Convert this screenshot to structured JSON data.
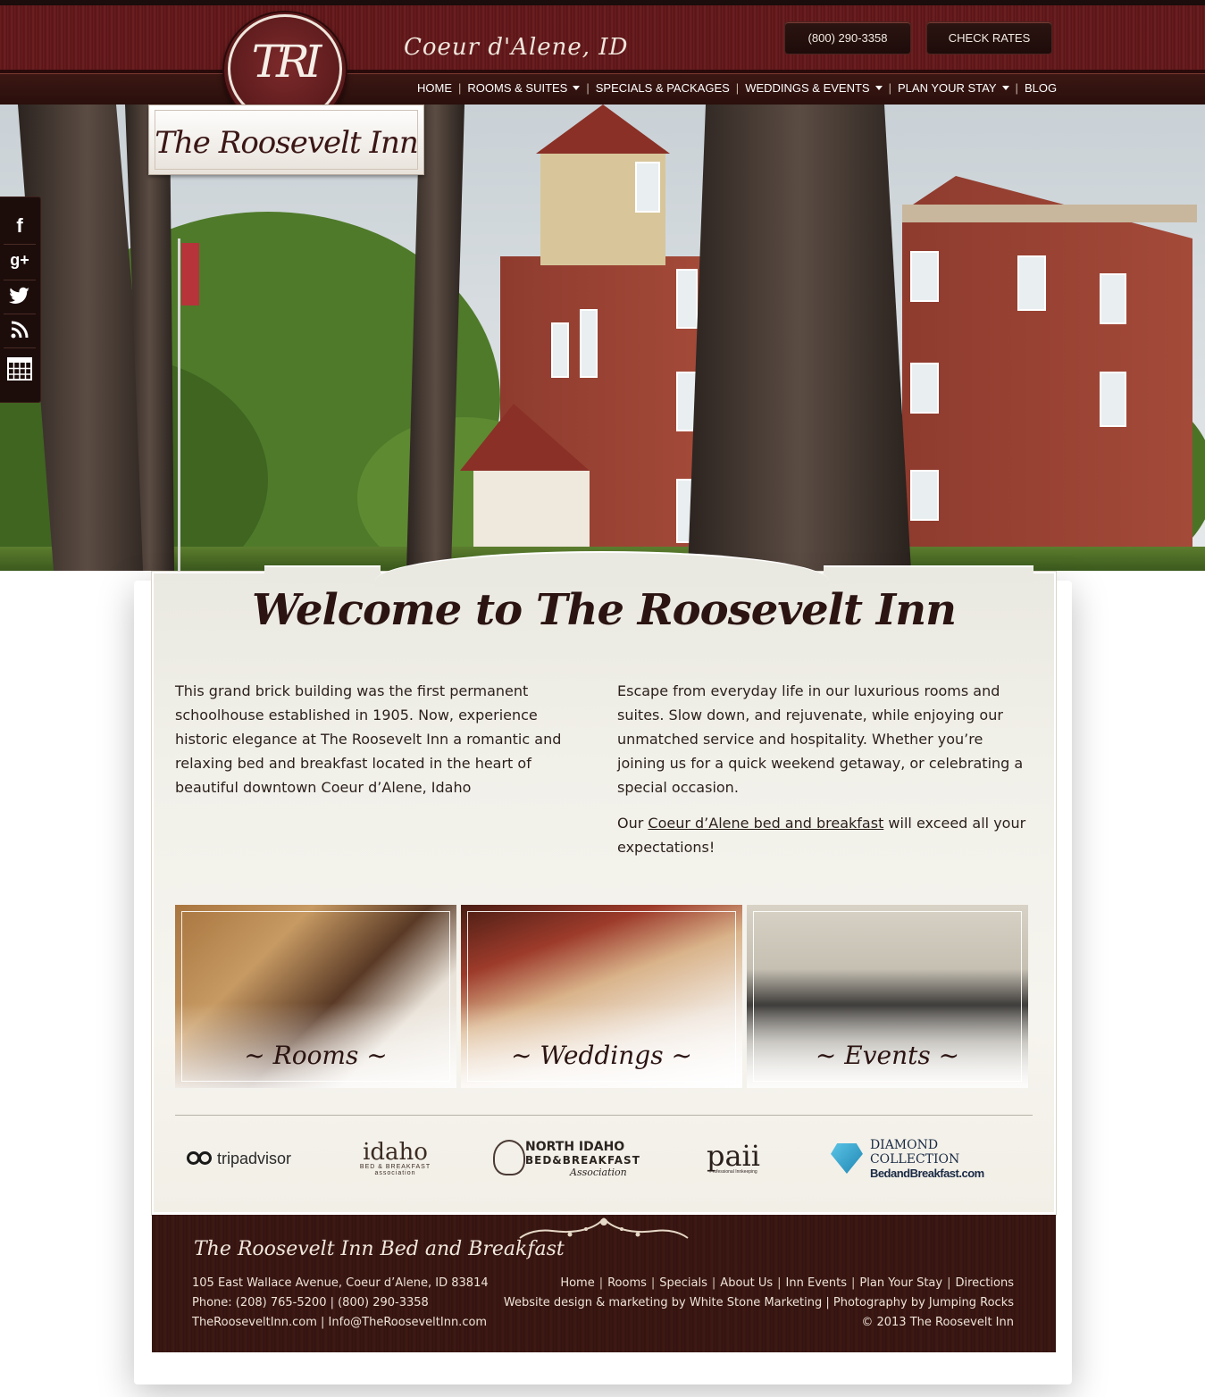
{
  "header": {
    "tagline": "Coeur d'Alene, ID",
    "phone_button": "(800) 290-3358",
    "rates_button": "CHECK RATES",
    "logo_monogram": "TRI",
    "logo_name": "The Roosevelt Inn"
  },
  "nav": {
    "home": "HOME",
    "rooms": "ROOMS & SUITES",
    "specials": "SPECIALS & PACKAGES",
    "weddings": "WEDDINGS & EVENTS",
    "plan": "PLAN YOUR STAY",
    "blog": "BLOG",
    "separator": "|"
  },
  "social": {
    "facebook": "f",
    "googleplus": "g+",
    "twitter": "twitter-icon",
    "rss": "rss-icon",
    "calendar": "calendar-icon"
  },
  "welcome": {
    "title": "Welcome to The Roosevelt Inn",
    "left_paragraph": "This grand brick building was the first permanent schoolhouse established in 1905. Now, experience historic elegance at The Roosevelt Inn a romantic and relaxing bed and breakfast located in the heart of beautiful downtown Coeur d’Alene, Idaho",
    "right_paragraph": "Escape from everyday life in our luxurious rooms and suites. Slow down, and rejuvenate, while enjoying our unmatched service and hospitality. Whether you’re joining us for a quick weekend getaway, or celebrating a special occasion.",
    "right_p2_before": "Our ",
    "right_p2_link": "Coeur d’Alene bed and breakfast",
    "right_p2_after": " will exceed all your expectations!"
  },
  "tiles": {
    "rooms": "~ Rooms ~",
    "weddings": "~ Weddings ~",
    "events": "~ Events ~"
  },
  "partners": {
    "tripadvisor": "tripadvisor",
    "idaho_big": "idaho",
    "idaho_small1": "BED & BREAKFAST",
    "idaho_small2": "association",
    "nib_l1": "NORTH IDAHO",
    "nib_l2": "BED&BREAKFAST",
    "nib_l3": "Association",
    "paii_big": "paii",
    "paii_small": "Professional Innkeeping",
    "diamond_l1": "DIAMOND COLLECTION",
    "diamond_l2": "BedandBreakfast.com"
  },
  "footer": {
    "title": "The Roosevelt Inn Bed and Breakfast",
    "address": "105 East Wallace Avenue, Coeur d’Alene, ID 83814",
    "phone": "Phone: (208) 765-5200 | (800) 290-3358",
    "contact": "TheRooseveltInn.com | Info@TheRooseveltInn.com",
    "links": [
      "Home",
      "Rooms",
      "Specials",
      "About Us",
      "Inn Events",
      "Plan Your Stay",
      "Directions"
    ],
    "credits": "Website design & marketing by White Stone Marketing | Photography by Jumping Rocks",
    "copyright": "© 2013 The Roosevelt Inn"
  },
  "colors": {
    "header_red": "#6b1d1f",
    "nav_dark": "#2a0f0c",
    "footer_brown": "#3b1713",
    "panel_cream": "#f1f0e9"
  }
}
